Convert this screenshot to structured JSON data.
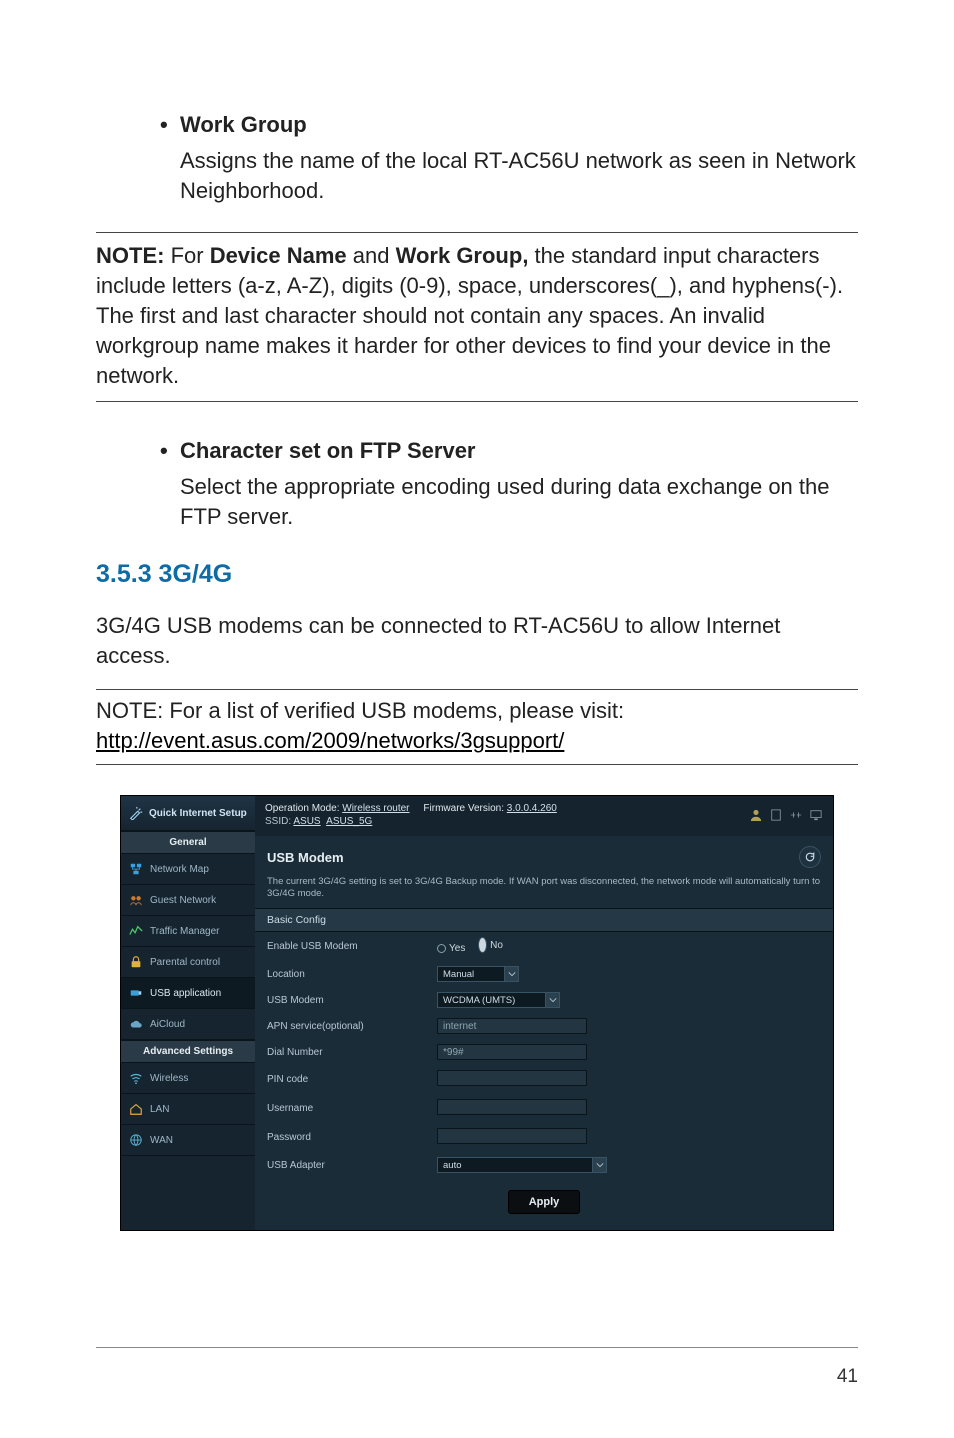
{
  "doc": {
    "work_group_title": "Work Group",
    "work_group_body": "Assigns the name of the local RT-AC56U network as seen in Network Neighborhood.",
    "note_prefix": "NOTE:",
    "note_span1": " For ",
    "note_strong2": "Device Name",
    "note_span2": " and ",
    "note_strong3": "Work Group,",
    "note_rest": " the standard input characters include letters (a-z, A-Z), digits (0-9), space, underscores(_), and hyphens(-). The first and last character should not contain any spaces. An invalid workgroup name makes it harder for other devices to find your device in the network.",
    "charset_title": "Character set on FTP Server",
    "charset_body": "Select the appropriate encoding used during data exchange on the FTP server.",
    "section_353": "3.5.3 3G/4G",
    "body_3g4g": "3G/4G USB modems can be connected to RT-AC56U to allow Internet access.",
    "subnote_lead": "NOTE:  For a list of verified USB modems, please visit:",
    "subnote_url": "http://event.asus.com/2009/networks/3gsupport/",
    "page_number": "41"
  },
  "router": {
    "qis": "Quick Internet Setup",
    "cat_general": "General",
    "side": {
      "network_map": "Network Map",
      "guest_network": "Guest Network",
      "traffic_manager": "Traffic Manager",
      "parental_control": "Parental control",
      "usb_application": "USB application",
      "aicloud": "AiCloud"
    },
    "cat_advanced": "Advanced Settings",
    "adv": {
      "wireless": "Wireless",
      "lan": "LAN",
      "wan": "WAN"
    },
    "top": {
      "op_mode_label": "Operation Mode: ",
      "op_mode_value": "Wireless router",
      "fw_label": "Firmware Version: ",
      "fw_value": "3.0.0.4.260",
      "ssid_label": "SSID: ",
      "ssid1": "ASUS",
      "ssid2": "ASUS_5G"
    },
    "panel": {
      "title": "USB Modem",
      "desc": "The current 3G/4G setting is set to 3G/4G Backup mode. If WAN port was disconnected, the network mode will automatically turn to 3G/4G mode.",
      "subheader": "Basic Config",
      "rows": {
        "enable_label": "Enable USB Modem",
        "yes": "Yes",
        "no": "No",
        "location_label": "Location",
        "location_value": "Manual",
        "usb_modem_label": "USB Modem",
        "usb_modem_value": "WCDMA (UMTS)",
        "apn_label": "APN service(optional)",
        "apn_value": "internet",
        "dial_label": "Dial Number",
        "dial_value": "*99#",
        "pin_label": "PIN code",
        "user_label": "Username",
        "pass_label": "Password",
        "adapter_label": "USB Adapter",
        "adapter_value": "auto"
      },
      "apply": "Apply"
    }
  }
}
